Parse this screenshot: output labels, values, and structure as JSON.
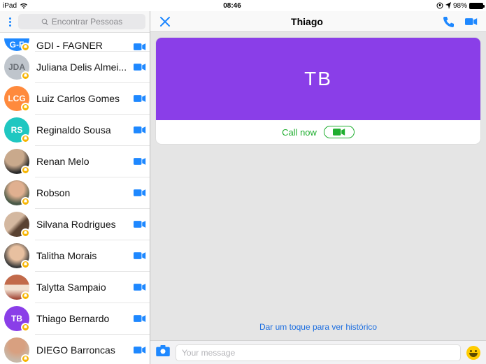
{
  "status": {
    "device": "iPad",
    "time": "08:46",
    "battery_pct": "98%"
  },
  "sidebar": {
    "search_placeholder": "Encontrar Pessoas",
    "contacts": [
      {
        "name": "GDI - FAGNER",
        "initials": "G-F",
        "avatar_class": "bg-blue",
        "cut": true
      },
      {
        "name": "Juliana Delis Almei...",
        "initials": "JDA",
        "avatar_class": "bg-grey"
      },
      {
        "name": "Luiz Carlos Gomes",
        "initials": "LCG",
        "avatar_class": "bg-orange"
      },
      {
        "name": "Reginaldo Sousa",
        "initials": "RS",
        "avatar_class": "bg-teal"
      },
      {
        "name": "Renan Melo",
        "initials": "",
        "avatar_class": "bg-photo1"
      },
      {
        "name": "Robson",
        "initials": "",
        "avatar_class": "bg-photo2"
      },
      {
        "name": "Silvana Rodrigues",
        "initials": "",
        "avatar_class": "bg-photo3"
      },
      {
        "name": "Talitha Morais",
        "initials": "",
        "avatar_class": "bg-photo4"
      },
      {
        "name": "Talytta Sampaio",
        "initials": "",
        "avatar_class": "bg-photo5"
      },
      {
        "name": "Thiago Bernardo",
        "initials": "TB",
        "avatar_class": "bg-purple"
      },
      {
        "name": "DIEGO Barroncas",
        "initials": "",
        "avatar_class": "bg-photo6"
      }
    ]
  },
  "chat": {
    "title": "Thiago",
    "hero_initials": "TB",
    "call_now_label": "Call now",
    "history_hint": "Dar um toque para ver histórico",
    "message_placeholder": "Your message"
  },
  "colors": {
    "accent": "#1e88ff",
    "hero": "#8a3ee8",
    "call": "#1fae2f"
  }
}
